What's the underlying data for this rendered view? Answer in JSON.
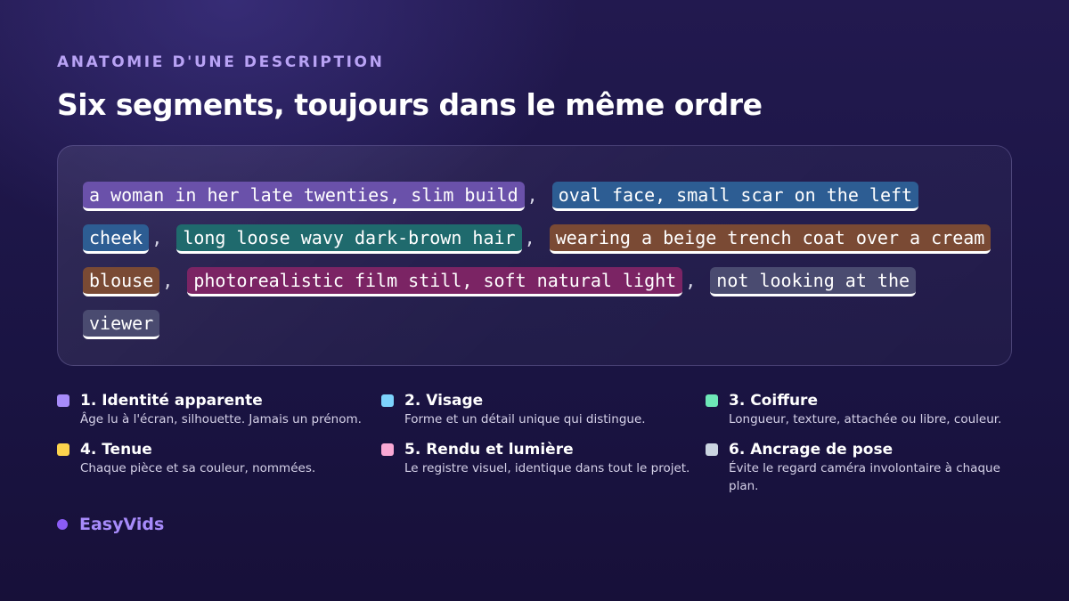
{
  "eyebrow": "ANATOMIE D'UNE DESCRIPTION",
  "title": "Six segments, toujours dans le même ordre",
  "separator": ",",
  "segments": [
    {
      "text": "a woman in her late twenties, slim build",
      "color": "#6a51aa"
    },
    {
      "text": "oval face, small scar on the left cheek",
      "color": "#2d5d93"
    },
    {
      "text": "long loose wavy dark-brown hair",
      "color": "#1f6a6d"
    },
    {
      "text": "wearing a beige trench coat over a cream blouse",
      "color": "#7a4a34"
    },
    {
      "text": "photorealistic film still, soft natural light",
      "color": "#7b2464"
    },
    {
      "text": "not looking at the viewer",
      "color": "#4a4b70"
    }
  ],
  "legend": [
    {
      "title": "1. Identité apparente",
      "desc": "Âge lu à l'écran, silhouette. Jamais un prénom.",
      "color": "#a78bfa"
    },
    {
      "title": "2. Visage",
      "desc": "Forme et un détail unique qui distingue.",
      "color": "#7dd3fc"
    },
    {
      "title": "3. Coiffure",
      "desc": "Longueur, texture, attachée ou libre, couleur.",
      "color": "#6ee7b7"
    },
    {
      "title": "4. Tenue",
      "desc": "Chaque pièce et sa couleur, nommées.",
      "color": "#fcd34d"
    },
    {
      "title": "5. Rendu et lumière",
      "desc": "Le registre visuel, identique dans tout le projet.",
      "color": "#f9a8d4"
    },
    {
      "title": "6. Ancrage de pose",
      "desc": "Évite le regard caméra involontaire à chaque plan.",
      "color": "#cbd5e1"
    }
  ],
  "brand": {
    "name": "EasyVids",
    "color": "#a78bfa"
  }
}
